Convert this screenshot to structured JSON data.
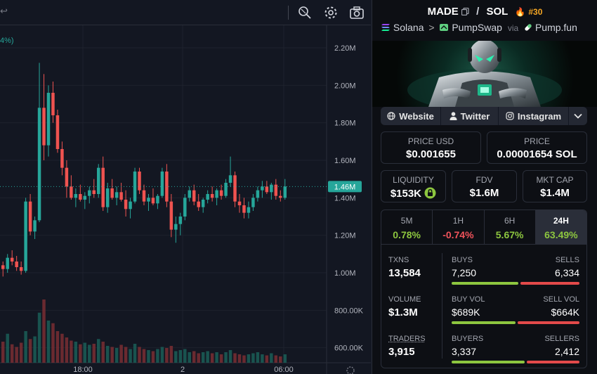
{
  "toolbar": {
    "icons": [
      "back-arrow-icon",
      "crosshair-icon",
      "gear-icon",
      "camera-icon"
    ]
  },
  "chart_data": {
    "type": "candlestick",
    "change_label": "4%)",
    "y_ticks": [
      "2.20M",
      "2.00M",
      "1.80M",
      "1.60M",
      "1.40M",
      "1.20M",
      "1.00M",
      "800.00K",
      "600.00K"
    ],
    "y_tick_values": [
      2200000,
      2000000,
      1800000,
      1600000,
      1400000,
      1200000,
      1000000,
      800000,
      600000
    ],
    "x_ticks": [
      "18:00",
      "2",
      "06:00"
    ],
    "current_price_label": "1.46M",
    "current_price": 1460000,
    "ylim": [
      520000,
      2320000
    ],
    "candles": [
      [
        1040,
        1060,
        980,
        1020
      ],
      [
        1020,
        1100,
        1000,
        1080
      ],
      [
        1080,
        1120,
        1040,
        1060
      ],
      [
        1060,
        1090,
        1010,
        1030
      ],
      [
        1030,
        1060,
        990,
        1010
      ],
      [
        1010,
        1400,
        1000,
        1380
      ],
      [
        1380,
        1420,
        1200,
        1220
      ],
      [
        1220,
        1300,
        1180,
        1280
      ],
      [
        1280,
        2120,
        1270,
        1880
      ],
      [
        1880,
        2060,
        1600,
        1680
      ],
      [
        1680,
        2000,
        1620,
        1960
      ],
      [
        1960,
        2020,
        1800,
        1840
      ],
      [
        1840,
        1870,
        1640,
        1660
      ],
      [
        1660,
        1700,
        1520,
        1560
      ],
      [
        1560,
        1600,
        1400,
        1460
      ],
      [
        1460,
        1520,
        1390,
        1400
      ],
      [
        1400,
        1450,
        1350,
        1420
      ],
      [
        1420,
        1470,
        1380,
        1390
      ],
      [
        1390,
        1430,
        1340,
        1410
      ],
      [
        1410,
        1460,
        1370,
        1440
      ],
      [
        1440,
        1500,
        1400,
        1420
      ],
      [
        1420,
        1580,
        1400,
        1560
      ],
      [
        1560,
        1620,
        1330,
        1350
      ],
      [
        1350,
        1480,
        1320,
        1450
      ],
      [
        1450,
        1500,
        1390,
        1400
      ],
      [
        1400,
        1460,
        1360,
        1430
      ],
      [
        1430,
        1480,
        1380,
        1390
      ],
      [
        1390,
        1440,
        1300,
        1340
      ],
      [
        1340,
        1400,
        1290,
        1380
      ],
      [
        1380,
        1560,
        1370,
        1540
      ],
      [
        1540,
        1560,
        1420,
        1440
      ],
      [
        1440,
        1470,
        1360,
        1380
      ],
      [
        1380,
        1420,
        1330,
        1400
      ],
      [
        1400,
        1450,
        1360,
        1370
      ],
      [
        1370,
        1420,
        1340,
        1410
      ],
      [
        1410,
        1560,
        1400,
        1540
      ],
      [
        1540,
        1580,
        1350,
        1380
      ],
      [
        1380,
        1420,
        1190,
        1230
      ],
      [
        1230,
        1300,
        1160,
        1260
      ],
      [
        1260,
        1320,
        1200,
        1300
      ],
      [
        1300,
        1420,
        1280,
        1400
      ],
      [
        1400,
        1460,
        1380,
        1440
      ],
      [
        1440,
        1470,
        1360,
        1380
      ],
      [
        1380,
        1420,
        1330,
        1350
      ],
      [
        1350,
        1400,
        1320,
        1390
      ],
      [
        1390,
        1440,
        1370,
        1420
      ],
      [
        1420,
        1460,
        1380,
        1400
      ],
      [
        1400,
        1450,
        1360,
        1440
      ],
      [
        1440,
        1470,
        1390,
        1410
      ],
      [
        1410,
        1500,
        1400,
        1480
      ],
      [
        1480,
        1620,
        1460,
        1520
      ],
      [
        1520,
        1540,
        1350,
        1380
      ],
      [
        1380,
        1420,
        1320,
        1360
      ],
      [
        1360,
        1400,
        1290,
        1320
      ],
      [
        1320,
        1380,
        1290,
        1350
      ],
      [
        1350,
        1420,
        1330,
        1400
      ],
      [
        1400,
        1460,
        1380,
        1440
      ],
      [
        1440,
        1490,
        1400,
        1460
      ],
      [
        1460,
        1490,
        1420,
        1430
      ],
      [
        1430,
        1480,
        1390,
        1470
      ],
      [
        1470,
        1500,
        1390,
        1410
      ],
      [
        1410,
        1440,
        1380,
        1400
      ],
      [
        1400,
        1500,
        1390,
        1460
      ]
    ],
    "volumes": [
      40,
      55,
      35,
      30,
      38,
      60,
      45,
      50,
      95,
      120,
      80,
      75,
      60,
      55,
      48,
      42,
      40,
      35,
      38,
      34,
      36,
      45,
      40,
      32,
      30,
      28,
      34,
      30,
      26,
      36,
      30,
      26,
      24,
      22,
      26,
      30,
      28,
      32,
      22,
      24,
      26,
      20,
      22,
      18,
      20,
      22,
      18,
      20,
      16,
      20,
      24,
      18,
      16,
      14,
      16,
      18,
      20,
      16,
      14,
      18,
      14,
      12,
      16
    ]
  },
  "header": {
    "token": "MADE",
    "copy_icon": "copy-icon",
    "slash": "/",
    "quote": "SOL",
    "rank_icon": "flame-icon",
    "rank": "#30"
  },
  "breadcrumb": {
    "chain": "Solana",
    "sep": ">",
    "dex": "PumpSwap",
    "via": "via",
    "launchpad": "Pump.fun"
  },
  "links": {
    "website": "Website",
    "twitter": "Twitter",
    "instagram": "Instagram"
  },
  "metrics": {
    "price_usd_label": "PRICE USD",
    "price_usd": "$0.001655",
    "price_label": "PRICE",
    "price": "0.00001654 SOL",
    "liquidity_label": "LIQUIDITY",
    "liquidity": "$153K",
    "fdv_label": "FDV",
    "fdv": "$1.6M",
    "mktcap_label": "MKT CAP",
    "mktcap": "$1.4M"
  },
  "timeframes": [
    {
      "label": "5M",
      "value": "0.78%",
      "color": "#8dc63f"
    },
    {
      "label": "1H",
      "value": "-0.74%",
      "color": "#f0535b"
    },
    {
      "label": "6H",
      "value": "5.67%",
      "color": "#8dc63f"
    },
    {
      "label": "24H",
      "value": "63.49%",
      "color": "#8dc63f"
    }
  ],
  "stats": {
    "txns_label": "TXNS",
    "txns": "13,584",
    "buys_label": "BUYS",
    "buys": "7,250",
    "sells_label": "SELLS",
    "sells": "6,334",
    "buy_share": 0.53,
    "volume_label": "VOLUME",
    "volume": "$1.3M",
    "buy_vol_label": "BUY VOL",
    "buy_vol": "$689K",
    "sell_vol_label": "SELL VOL",
    "sell_vol": "$664K",
    "buy_vol_share": 0.51,
    "traders_label": "TRADERS",
    "traders": "3,915",
    "buyers_label": "BUYERS",
    "buyers": "3,337",
    "sellers_label": "SELLERS",
    "sellers": "2,412",
    "buyer_share": 0.58
  },
  "colors": {
    "up": "#26a69a",
    "down": "#ef5350",
    "accent_green": "#8dc63f",
    "accent_red": "#e34a4a",
    "rank": "#f5a623"
  }
}
